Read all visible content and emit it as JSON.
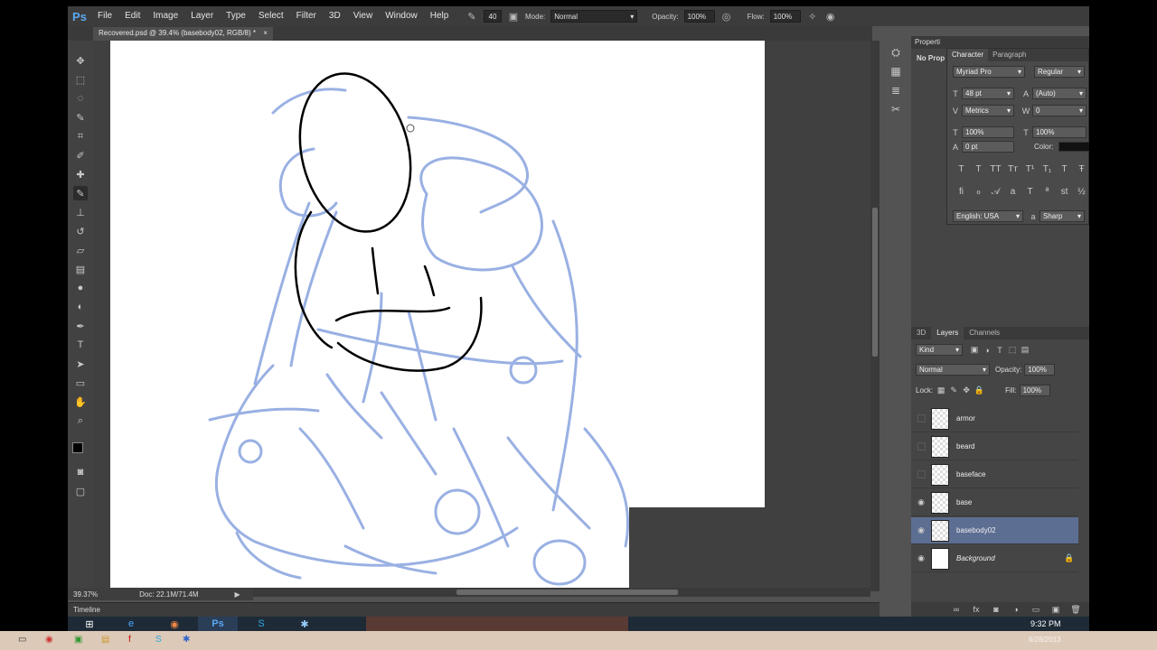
{
  "menubar": {
    "logo": "Ps",
    "items": [
      "File",
      "Edit",
      "Image",
      "Layer",
      "Type",
      "Select",
      "Filter",
      "3D",
      "View",
      "Window",
      "Help"
    ]
  },
  "options": {
    "brush_size": "40",
    "mode_label": "Mode:",
    "mode_value": "Normal",
    "opacity_label": "Opacity:",
    "opacity_value": "100%",
    "flow_label": "Flow:",
    "flow_value": "100%"
  },
  "document": {
    "tab_title": "Recovered.psd @ 39.4% (basebody02, RGB/8) *",
    "tab_close": "×"
  },
  "status": {
    "zoom": "39.37%",
    "doc_info": "Doc: 22.1M/71.4M"
  },
  "timeline": {
    "label": "Timeline"
  },
  "properties": {
    "header": "Properti",
    "body": "No Prop"
  },
  "character": {
    "tabs": [
      "Character",
      "Paragraph"
    ],
    "font_family": "Myriad Pro",
    "font_style": "Regular",
    "size": "48 pt",
    "leading": "(Auto)",
    "kerning": "Metrics",
    "tracking": "0",
    "vscale": "100%",
    "hscale": "100%",
    "baseline": "0 pt",
    "color_label": "Color:",
    "language": "English: USA",
    "antialias": "Sharp"
  },
  "layers": {
    "tabs": [
      "3D",
      "Layers",
      "Channels"
    ],
    "kind": "Kind",
    "blend": "Normal",
    "opacity_label": "Opacity:",
    "opacity_value": "100%",
    "lock_label": "Lock:",
    "fill_label": "Fill:",
    "fill_value": "100%",
    "items": [
      {
        "name": "armor",
        "visible": false
      },
      {
        "name": "beard",
        "visible": false
      },
      {
        "name": "baseface",
        "visible": false
      },
      {
        "name": "base",
        "visible": true
      },
      {
        "name": "basebody02",
        "visible": true,
        "selected": true
      },
      {
        "name": "Background",
        "visible": true,
        "locked": true
      }
    ]
  },
  "taskbar": {
    "time": "9:32 PM",
    "date": "6/28/2013"
  },
  "colors": {
    "sketch_blue": "#8fa8e0",
    "ink": "#000000",
    "selected_layer": "#5c6e92"
  }
}
